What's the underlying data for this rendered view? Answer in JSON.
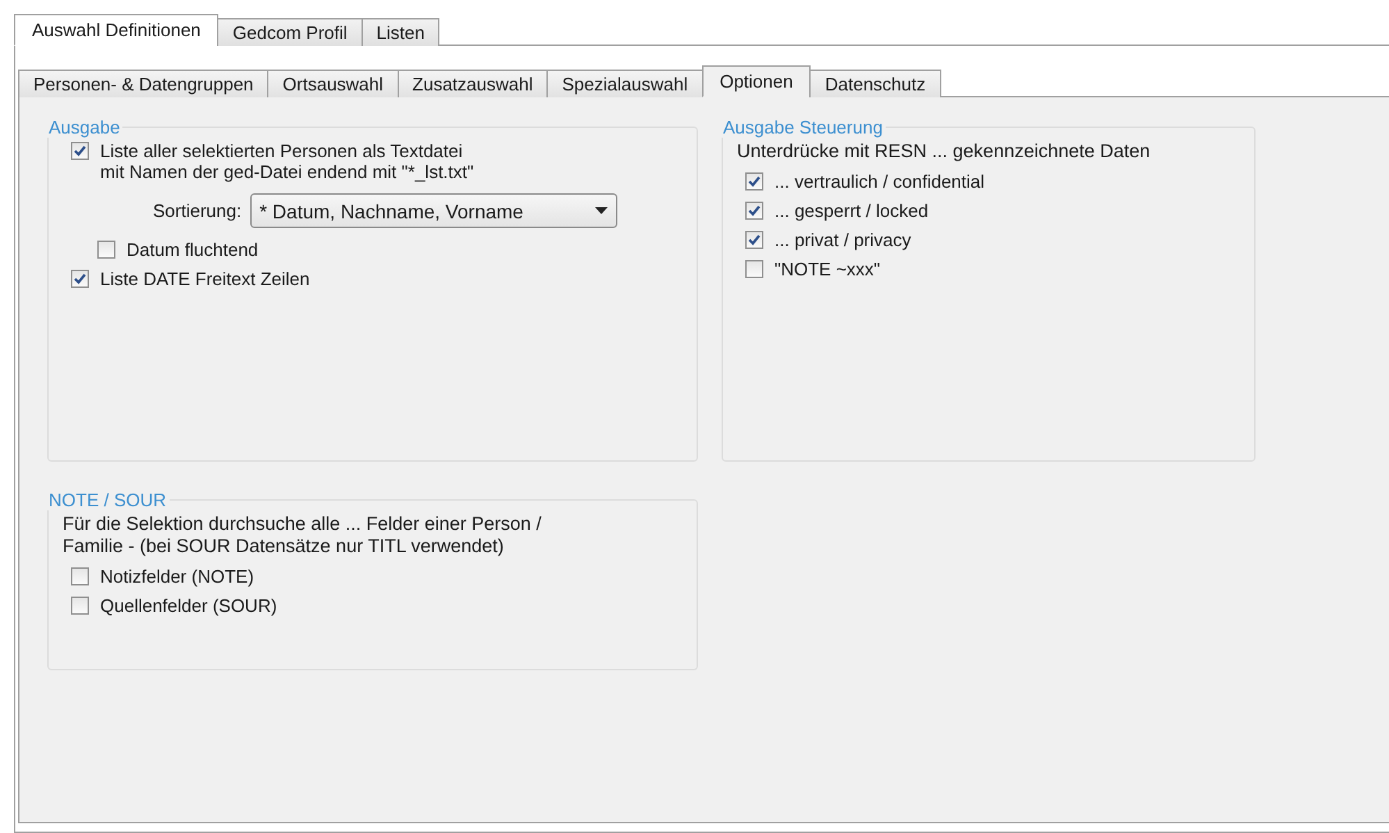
{
  "outer_tabs": [
    {
      "label": "Auswahl Definitionen",
      "selected": true
    },
    {
      "label": "Gedcom Profil",
      "selected": false
    },
    {
      "label": "Listen",
      "selected": false
    }
  ],
  "inner_tabs": [
    {
      "label": "Personen- & Datengruppen",
      "selected": false
    },
    {
      "label": "Ortsauswahl",
      "selected": false
    },
    {
      "label": "Zusatzauswahl",
      "selected": false
    },
    {
      "label": "Spezialauswahl",
      "selected": false
    },
    {
      "label": "Optionen",
      "selected": true
    },
    {
      "label": "Datenschutz",
      "selected": false
    }
  ],
  "groups": [
    {
      "title": "Ausgabe",
      "items": [
        {
          "kind": "checkbox",
          "label": "Liste aller selektierten Personen als Textdatei\nmit Namen der ged-Datei endend mit \"*_lst.txt\"",
          "checked": true,
          "children": [
            {
              "kind": "select",
              "label": "Sortierung:",
              "value": "* Datum, Nachname, Vorname"
            },
            {
              "kind": "checkbox",
              "label": "Datum fluchtend",
              "checked": false
            }
          ]
        },
        {
          "kind": "checkbox",
          "label": "Liste DATE Freitext Zeilen",
          "checked": true
        }
      ]
    },
    {
      "title": "Ausgabe Steuerung",
      "items": [
        {
          "kind": "text",
          "text": "Unterdrücke mit RESN ... gekennzeichnete Daten"
        },
        {
          "kind": "checkbox",
          "label": "... vertraulich / confidential",
          "checked": true
        },
        {
          "kind": "checkbox",
          "label": "... gesperrt / locked",
          "checked": true
        },
        {
          "kind": "checkbox",
          "label": "... privat / privacy",
          "checked": true
        },
        {
          "kind": "checkbox",
          "label": "\"NOTE ~xxx\"",
          "checked": false
        }
      ]
    },
    {
      "title": "NOTE / SOUR",
      "items": [
        {
          "kind": "text",
          "text": "Für die Selektion durchsuche alle ... Felder einer Person /\nFamilie - (bei SOUR Datensätze nur TITL verwendet)"
        },
        {
          "kind": "checkbox",
          "label": "Notizfelder (NOTE)",
          "checked": false
        },
        {
          "kind": "checkbox",
          "label": "Quellenfelder (SOUR)",
          "checked": false
        }
      ]
    }
  ]
}
